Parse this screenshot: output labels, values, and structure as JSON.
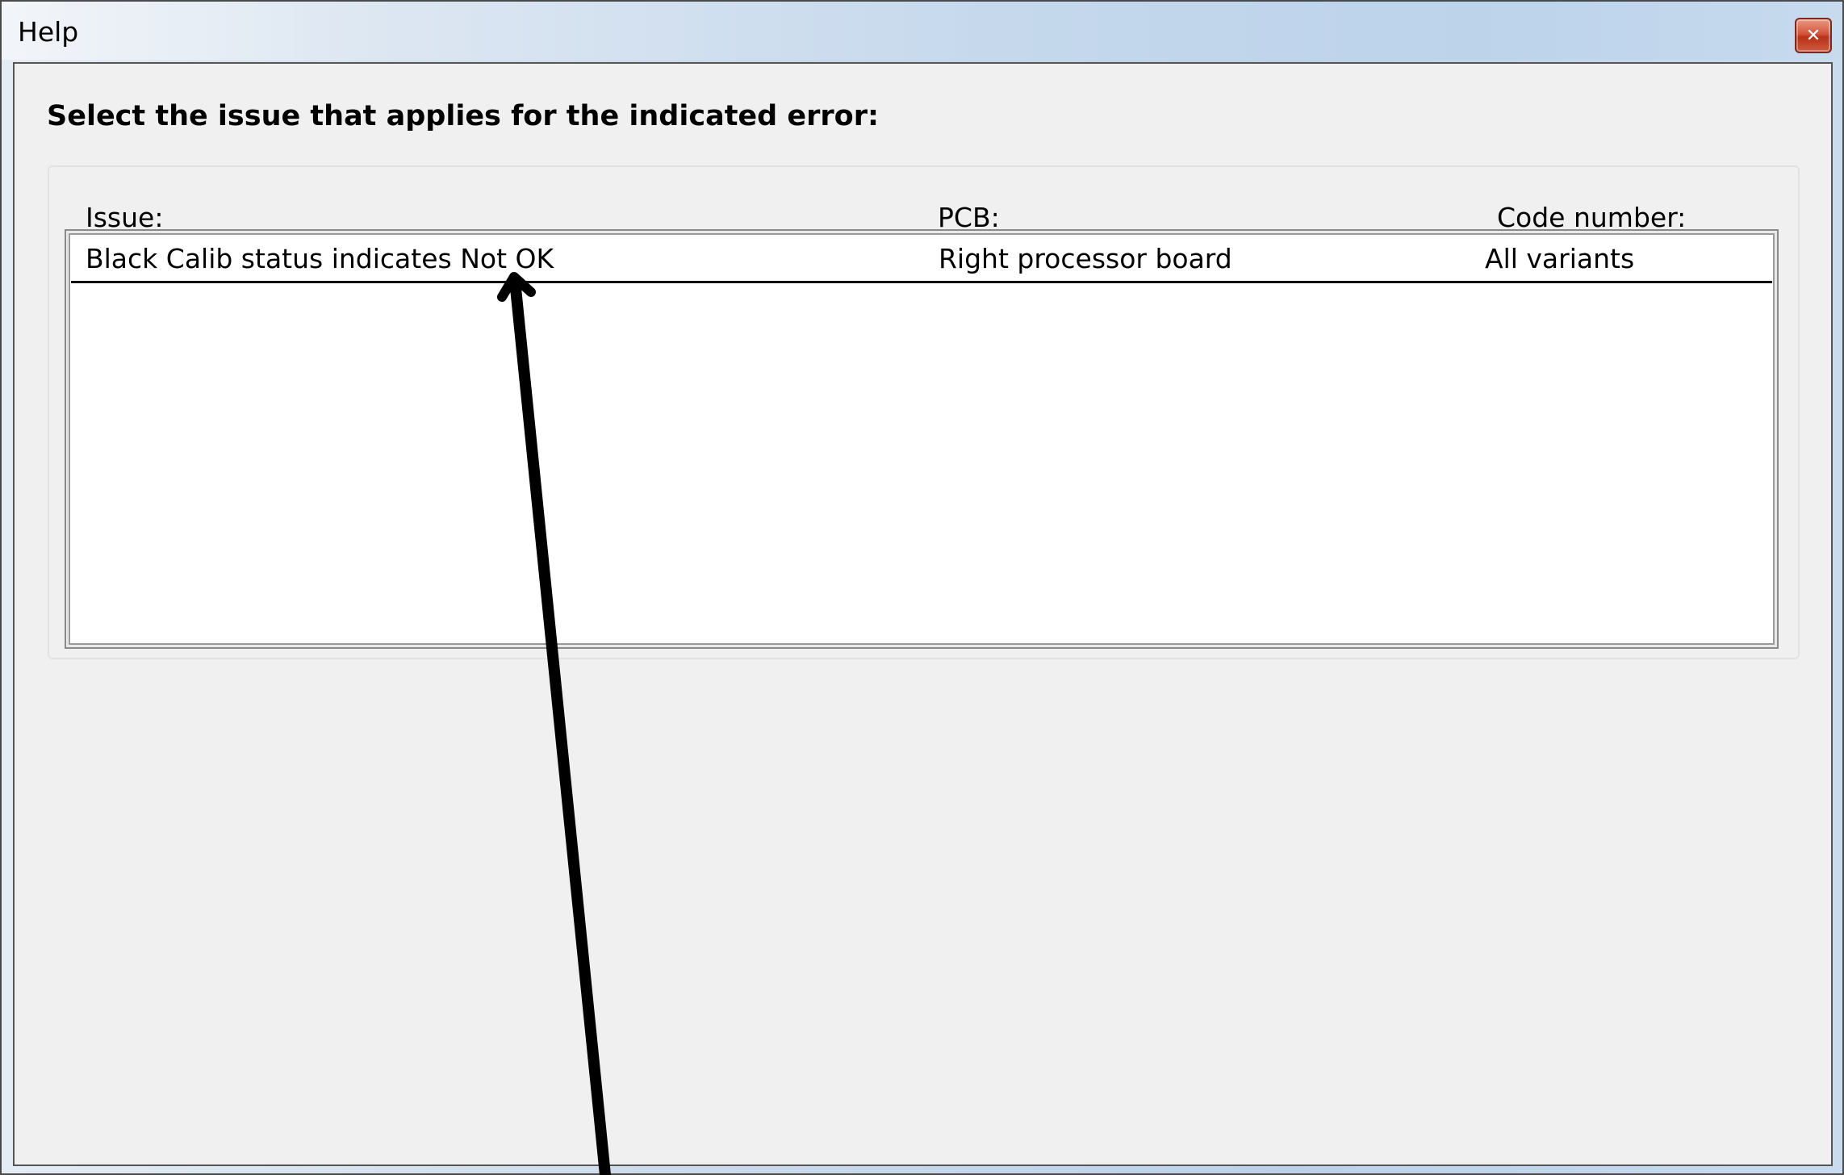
{
  "window": {
    "title": "Help"
  },
  "icons": {
    "close": "close-icon"
  },
  "dialog": {
    "heading": "Select the issue that applies for the indicated error:",
    "columns": {
      "issue": "Issue:",
      "pcb": "PCB:",
      "code_number": "Code number:"
    },
    "rows": [
      {
        "issue": "Black Calib status indicates Not OK",
        "pcb": "Right processor board",
        "code_number": "All variants"
      }
    ]
  },
  "colors": {
    "annotation_arrow": "#000000",
    "client_background": "#f0f0f0",
    "close_button": "#c8442a"
  }
}
